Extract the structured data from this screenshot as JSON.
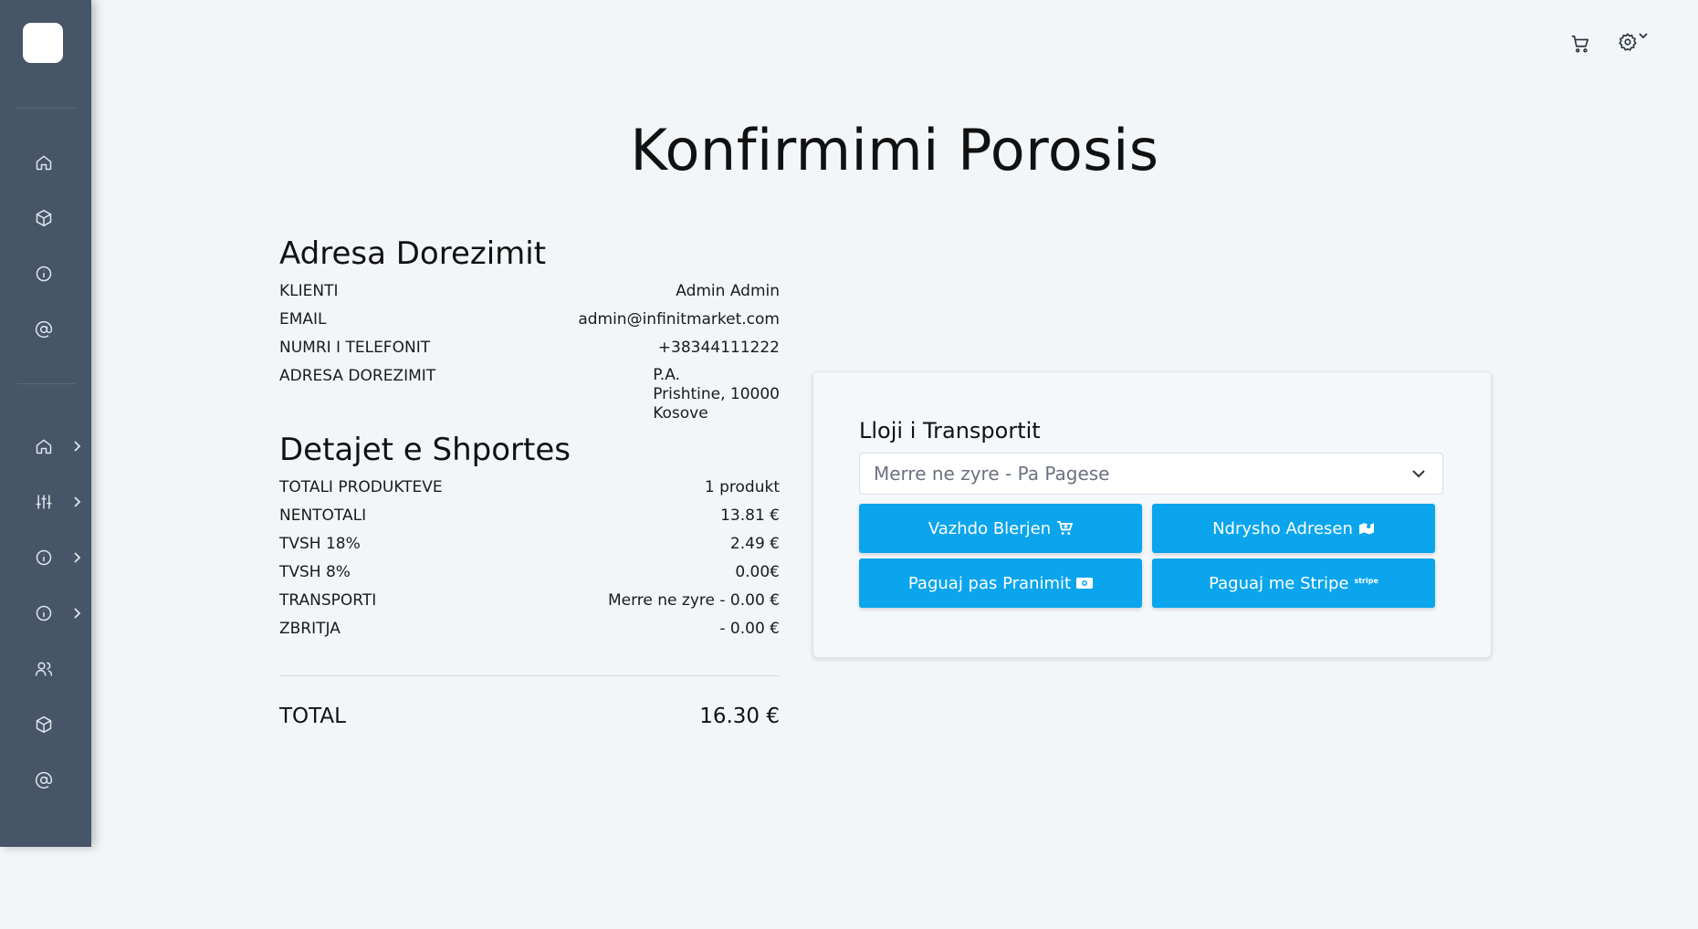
{
  "header": {
    "cart_icon": "cart-icon",
    "settings_icon": "gear-icon"
  },
  "sidebar": {
    "items": [
      {
        "icon": "home-icon"
      },
      {
        "icon": "box-icon"
      },
      {
        "icon": "info-icon"
      },
      {
        "icon": "at-icon"
      },
      {
        "icon": "home-icon",
        "expandable": true
      },
      {
        "icon": "sliders-icon",
        "expandable": true
      },
      {
        "icon": "info-icon",
        "expandable": true
      },
      {
        "icon": "info-icon",
        "expandable": true
      },
      {
        "icon": "users-icon"
      },
      {
        "icon": "box-icon"
      },
      {
        "icon": "at-icon"
      }
    ]
  },
  "page": {
    "title": "Konfirmimi Porosis"
  },
  "address": {
    "heading": "Adresa Dorezimit",
    "client_label": "KLIENTI",
    "client_value": "Admin Admin",
    "email_label": "EMAIL",
    "email_value": "admin@infinitmarket.com",
    "phone_label": "NUMRI I TELEFONIT",
    "phone_value": "+38344111222",
    "address_label": "ADRESA DOREZIMIT",
    "address_line1": "P.A.",
    "address_line2": "Prishtine, 10000",
    "address_line3": "Kosove"
  },
  "cart": {
    "heading": "Detajet e Shportes",
    "products_label": "TOTALI PRODUKTEVE",
    "products_value": "1 produkt",
    "subtotal_label": "NENTOTALI",
    "subtotal_value": "13.81 €",
    "vat18_label": "TVSH 18%",
    "vat18_value": "2.49 €",
    "vat8_label": "TVSH 8%",
    "vat8_value": "0.00€",
    "transport_label": "TRANSPORTI",
    "transport_value": "Merre ne zyre - 0.00 €",
    "discount_label": "ZBRITJA",
    "discount_value": "- 0.00 €",
    "total_label": "TOTAL",
    "total_value": "16.30 €"
  },
  "transport": {
    "label": "Lloji i Transportit",
    "selected": "Merre ne zyre - Pa Pagese"
  },
  "actions": {
    "continue_label": "Vazhdo Blerjen",
    "change_address_label": "Ndrysho Adresen",
    "pay_on_delivery_label": "Paguaj pas Pranimit",
    "pay_stripe_label": "Paguaj me Stripe",
    "stripe_mark": "stripe"
  },
  "colors": {
    "sidebar": "#465568",
    "background": "#f3f6f9",
    "button": "#0aa5ec"
  }
}
